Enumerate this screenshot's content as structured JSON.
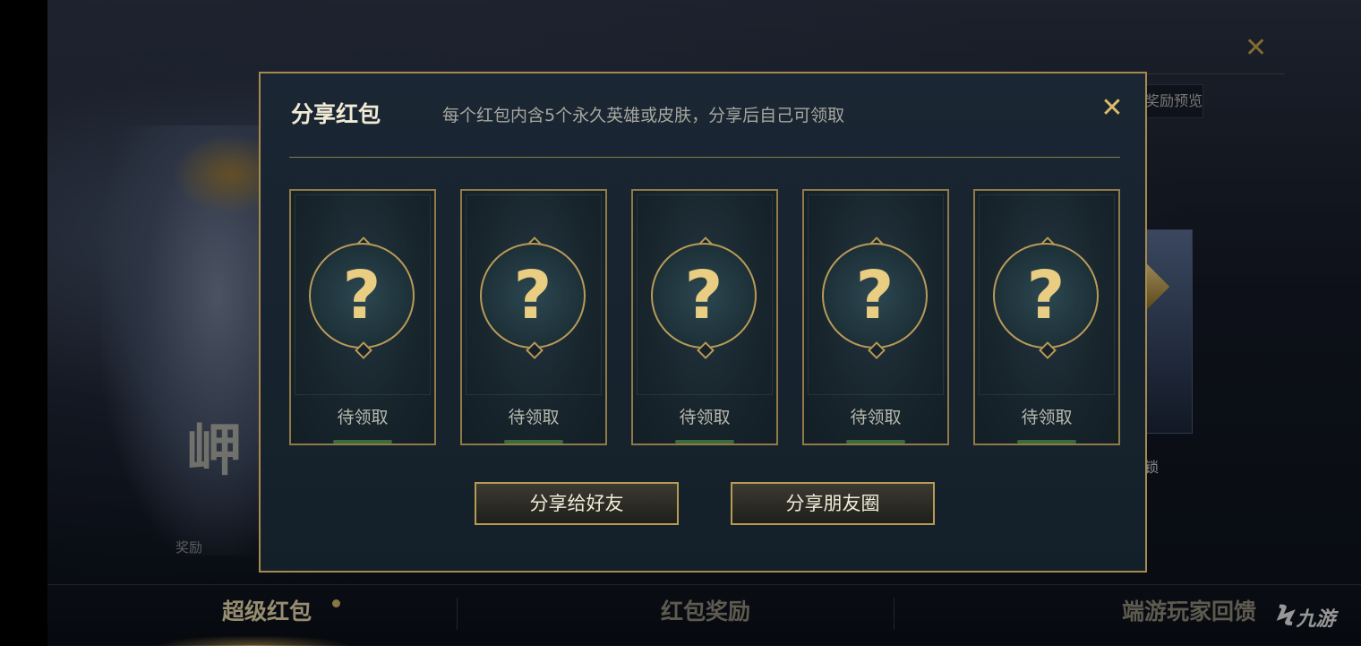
{
  "background": {
    "hero_big_char": "岬",
    "hero_small_text": "奖励",
    "preview_label": "奖励预览",
    "unlock_label": "天后解锁"
  },
  "tabs": [
    {
      "label": "超级红包",
      "active": true
    },
    {
      "label": "红包奖励",
      "active": false
    },
    {
      "label": "端游玩家回馈",
      "active": false
    }
  ],
  "watermark": "九游",
  "modal": {
    "title": "分享红包",
    "subtitle": "每个红包内含5个永久英雄或皮肤，分享后自己可领取",
    "cards": [
      {
        "symbol": "?",
        "status": "待领取"
      },
      {
        "symbol": "?",
        "status": "待领取"
      },
      {
        "symbol": "?",
        "status": "待领取"
      },
      {
        "symbol": "?",
        "status": "待领取"
      },
      {
        "symbol": "?",
        "status": "待领取"
      }
    ],
    "buttons": {
      "share_friend": "分享给好友",
      "share_moments": "分享朋友圈"
    }
  },
  "colors": {
    "accent_gold": "#b99a55",
    "modal_bg": "#1a2633",
    "question_mark": "#e9cd82"
  },
  "icons": {
    "close": "close-icon",
    "lock": "lock-icon"
  }
}
